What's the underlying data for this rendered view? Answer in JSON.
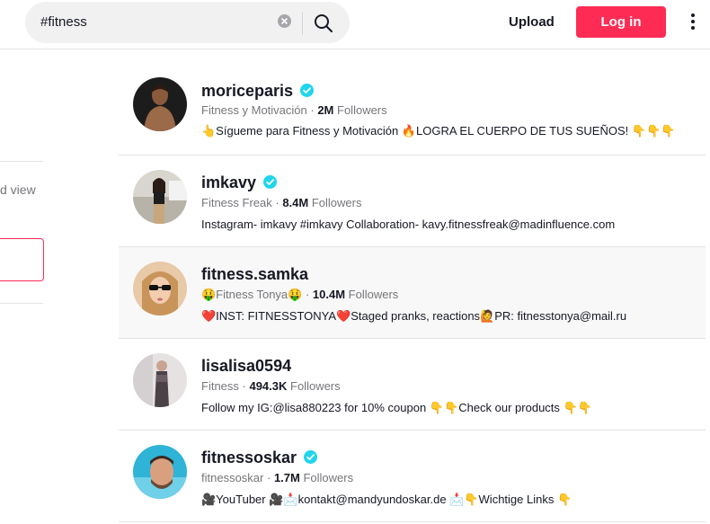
{
  "header": {
    "search_value": "#fitness",
    "upload_label": "Upload",
    "login_label": "Log in"
  },
  "sidebar": {
    "partial_text": "d view"
  },
  "colors": {
    "accent": "#fe2c55",
    "verified": "#20d5ec",
    "muted_text": "#75767a"
  },
  "results": [
    {
      "username": "moriceparis",
      "verified": true,
      "nickname": "Fitness y Motivación",
      "followers": "2M",
      "followers_label": "Followers",
      "bio": "👆Sígueme para Fitness y Motivación 🔥LOGRA EL CUERPO DE TUS SUEÑOS! 👇👇👇"
    },
    {
      "username": "imkavy",
      "verified": true,
      "nickname": "Fitness Freak",
      "followers": "8.4M",
      "followers_label": "Followers",
      "bio": "Instagram- imkavy #imkavy Collaboration- kavy.fitnessfreak@madinfluence.com"
    },
    {
      "username": "fitness.samka",
      "verified": false,
      "nickname": "🤑Fitness Tonya🤑",
      "followers": "10.4M",
      "followers_label": "Followers",
      "bio": "❤️INST: FITNESSTONYA❤️Staged pranks, reactions🙋PR: fitnesstonya@mail.ru"
    },
    {
      "username": "lisalisa0594",
      "verified": false,
      "nickname": "Fitness",
      "followers": "494.3K",
      "followers_label": "Followers",
      "bio": "Follow my IG:@lisa880223 for 10% coupon 👇👇Check our products 👇👇"
    },
    {
      "username": "fitnessoskar",
      "verified": true,
      "nickname": "fitnessoskar",
      "followers": "1.7M",
      "followers_label": "Followers",
      "bio": "🎥YouTuber 🎥📩kontakt@mandyundoskar.de 📩👇Wichtige Links 👇"
    }
  ]
}
